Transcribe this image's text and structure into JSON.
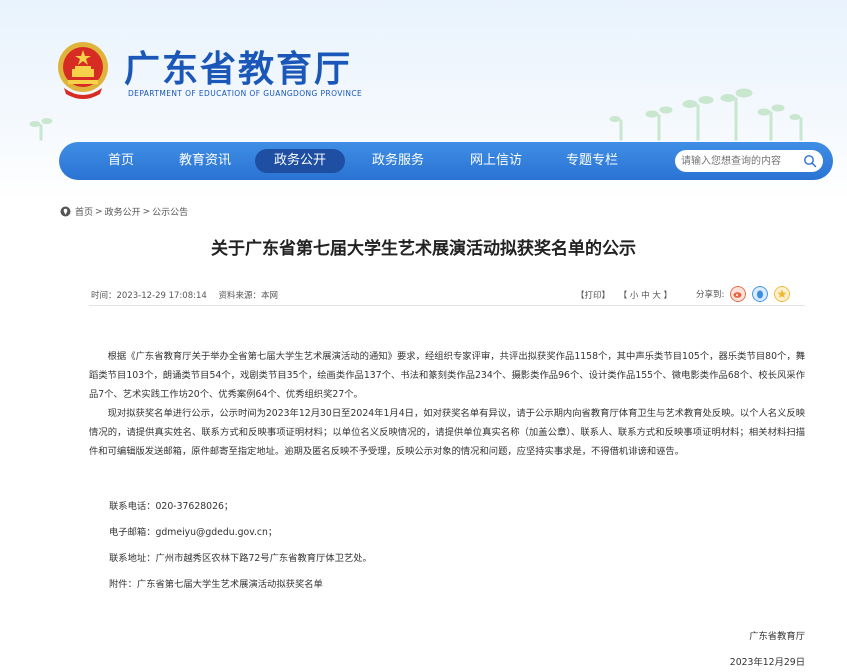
{
  "site": {
    "title": "广东省教育厅",
    "subtitle": "DEPARTMENT OF EDUCATION OF GUANGDONG PROVINCE",
    "emblem_icon": "national-emblem-icon"
  },
  "nav": {
    "items": [
      {
        "label": "首页",
        "active": false
      },
      {
        "label": "教育资讯",
        "active": false
      },
      {
        "label": "政务公开",
        "active": true
      },
      {
        "label": "政务服务",
        "active": false
      },
      {
        "label": "网上信访",
        "active": false
      },
      {
        "label": "专题专栏",
        "active": false
      }
    ],
    "search_placeholder": "请输入您想查询的内容"
  },
  "breadcrumb": {
    "items": [
      "首页",
      "政务公开",
      "公示公告"
    ],
    "separator": ">"
  },
  "article": {
    "title": "关于广东省第七届大学生艺术展演活动拟获奖名单的公示",
    "time": "时间：2023-12-29 17:08:14",
    "source": "资料来源：本网",
    "print_label": "【打印】",
    "font_label": "【 小   中   大 】",
    "share_label": "分享到:",
    "paragraphs": [
      "根据《广东省教育厅关于举办全省第七届大学生艺术展演活动的通知》要求，经组织专家评审，共评出拟获奖作品1158个，其中声乐类节目105个，器乐类节目80个，舞蹈类节目103个，朗诵类节目54个，戏剧类节目35个，绘画类作品137个、书法和篆刻类作品234个、摄影类作品96个、设计类作品155个、微电影类作品68个、校长风采作品7个、艺术实践工作坊20个、优秀案例64个、优秀组织奖27个。",
      "现对拟获奖名单进行公示，公示时间为2023年12月30日至2024年1月4日，如对获奖名单有异议，请于公示期内向省教育厅体育卫生与艺术教育处反映。以个人名义反映情况的，请提供真实姓名、联系方式和反映事项证明材料；以单位名义反映情况的，请提供单位真实名称（加盖公章）、联系人、联系方式和反映事项证明材料；相关材料扫描件和可编辑版发送邮箱，原件邮寄至指定地址。逾期及匿名反映不予受理，反映公示对象的情况和问题，应坚持实事求是，不得借机诽谤和诬告。"
    ],
    "phone": "联系电话：020-37628026；",
    "email": "电子邮箱：gdmeiyu@gdedu.gov.cn；",
    "address": "联系地址：广州市越秀区农林下路72号广东省教育厅体卫艺处。",
    "attachment": "附件：广东省第七届大学生艺术展演活动拟获奖名单",
    "signature": "广东省教育厅",
    "date": "2023年12月29日"
  },
  "colors": {
    "brand_blue": "#1a57b8",
    "nav_blue": "#2f7ddb",
    "nav_active": "#1e4fa3",
    "share_weibo": "#e8623e",
    "share_qq": "#3a8ee6",
    "share_qzone": "#f0b832"
  }
}
